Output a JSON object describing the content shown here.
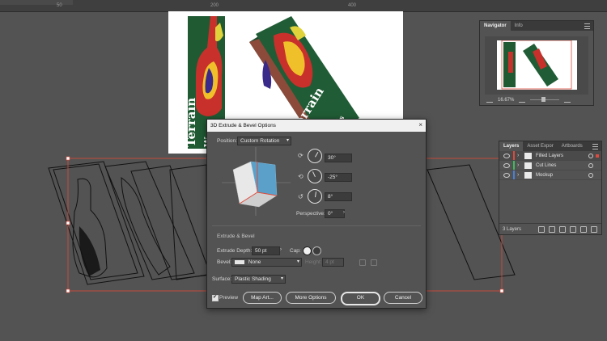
{
  "artwork": {
    "card_text": "Terrain",
    "card_text_2": "W",
    "card_text_3": "ards"
  },
  "navigator": {
    "tabs": [
      "Navigator",
      "Info"
    ],
    "zoom": "16.67%"
  },
  "layers": {
    "tabs": [
      "Layers",
      "Asset Expor",
      "Artboards"
    ],
    "items": [
      {
        "name": "Filled Layers",
        "color": "#d94b3f"
      },
      {
        "name": "Cut Lines",
        "color": "#3dbb5a"
      },
      {
        "name": "Mockup",
        "color": "#4a7fd6"
      }
    ],
    "count": "3 Layers"
  },
  "dialog": {
    "title": "3D Extrude & Bevel Options",
    "position_label": "Position:",
    "position_value": "Custom Rotation",
    "rotation_x": "30°",
    "rotation_y": "-25°",
    "rotation_z": "8°",
    "perspective_label": "Perspective:",
    "perspective_value": "0°",
    "section_extrude": "Extrude & Bevel",
    "extrude_depth_label": "Extrude Depth:",
    "extrude_depth_value": "50 pt",
    "cap_label": "Cap:",
    "bevel_label": "Bevel:",
    "bevel_value": "None",
    "height_label": "Height:",
    "height_value": "4 pt",
    "surface_label": "Surface:",
    "surface_value": "Plastic Shading",
    "preview_label": "Preview",
    "map_art_label": "Map Art...",
    "more_options_label": "More Options",
    "ok_label": "OK",
    "cancel_label": "Cancel"
  },
  "ruler_labels": [
    "50",
    "200",
    "400"
  ]
}
